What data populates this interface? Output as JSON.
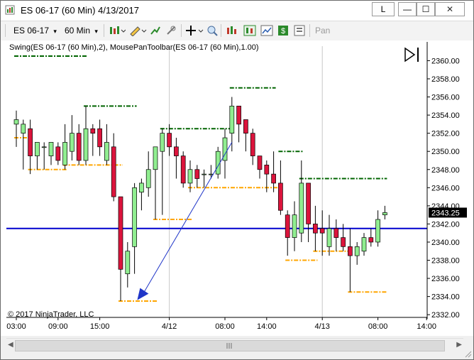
{
  "window": {
    "title": "ES 06-17 (60 Min)  4/13/2017",
    "buttons": {
      "link": "L",
      "minimize": "—",
      "maximize": "☐",
      "close": "✕"
    }
  },
  "toolbar": {
    "instrument": "ES 06-17",
    "interval": "60 Min",
    "dropdown_glyph": "▾",
    "pan_label": "Pan",
    "icons": [
      "bar-type-icon",
      "draw-pencil-icon",
      "indicator-icon",
      "attach-icon",
      "crosshair-icon",
      "zoom-icon",
      "strategies-icon",
      "data-box-icon",
      "chart-trader-icon",
      "dollar-icon",
      "properties-icon"
    ]
  },
  "chart": {
    "indicator_label": "Swing(ES 06-17 (60 Min),2), MousePanToolbar(ES 06-17 (60 Min),1.00)",
    "copyright": "© 2017 NinjaTrader, LLC",
    "last_price_label": "2343.25",
    "horizontal_line_price": 2341.5,
    "colors": {
      "up": "#90ee90",
      "down": "#dc143c",
      "wick": "#000000",
      "swing_high": "#006400",
      "swing_low": "#ffa500",
      "hline": "#0000cd",
      "arrow": "#1f35c8"
    },
    "x_ticks": [
      "03:00",
      "09:00",
      "15:00",
      "4/12",
      "08:00",
      "14:00",
      "4/13",
      "08:00",
      "14:00"
    ]
  },
  "chart_data": {
    "type": "candlestick",
    "y_ticks": [
      2332.0,
      2334.0,
      2336.0,
      2338.0,
      2340.0,
      2342.0,
      2344.0,
      2346.0,
      2348.0,
      2350.0,
      2352.0,
      2354.0,
      2356.0,
      2358.0,
      2360.0
    ],
    "ylim": [
      2331.7,
      2361.6
    ],
    "candles": [
      [
        2353.0,
        2354.5,
        2350.5,
        2353.5
      ],
      [
        2352.0,
        2353.5,
        2348.0,
        2353.0
      ],
      [
        2352.5,
        2353.5,
        2347.5,
        2349.5
      ],
      [
        2349.5,
        2351.0,
        2348.0,
        2351.0
      ],
      [
        2350.5,
        2351.0,
        2348.0,
        2350.5
      ],
      [
        2349.5,
        2351.0,
        2348.5,
        2351.0
      ],
      [
        2350.5,
        2351.0,
        2348.5,
        2349.0
      ],
      [
        2348.5,
        2353.0,
        2348.0,
        2351.0
      ],
      [
        2350.0,
        2354.0,
        2349.0,
        2352.0
      ],
      [
        2352.0,
        2353.0,
        2348.5,
        2349.0
      ],
      [
        2349.0,
        2355.0,
        2348.5,
        2352.5
      ],
      [
        2352.5,
        2353.0,
        2349.5,
        2352.0
      ],
      [
        2352.5,
        2353.5,
        2349.5,
        2350.5
      ],
      [
        2349.0,
        2353.0,
        2348.5,
        2351.0
      ],
      [
        2350.5,
        2352.0,
        2344.5,
        2345.0
      ],
      [
        2345.0,
        2345.0,
        2333.5,
        2337.0
      ],
      [
        2336.5,
        2340.0,
        2335.0,
        2339.0
      ],
      [
        2339.5,
        2346.5,
        2336.5,
        2346.0
      ],
      [
        2345.5,
        2347.0,
        2343.5,
        2346.5
      ],
      [
        2346.0,
        2350.0,
        2345.0,
        2348.0
      ],
      [
        2348.0,
        2350.5,
        2342.5,
        2350.5
      ],
      [
        2350.0,
        2352.5,
        2343.0,
        2352.0
      ],
      [
        2352.0,
        2353.0,
        2349.5,
        2350.5
      ],
      [
        2350.5,
        2351.5,
        2347.0,
        2349.5
      ],
      [
        2349.5,
        2350.0,
        2346.0,
        2346.5
      ],
      [
        2346.5,
        2349.0,
        2345.5,
        2348.0
      ],
      [
        2348.0,
        2348.5,
        2346.0,
        2347.0
      ],
      [
        2347.5,
        2348.0,
        2346.0,
        2347.5
      ],
      [
        2347.5,
        2348.5,
        2347.0,
        2347.5
      ],
      [
        2347.5,
        2350.5,
        2347.0,
        2350.0
      ],
      [
        2349.0,
        2352.5,
        2347.0,
        2351.5
      ],
      [
        2352.0,
        2356.0,
        2350.0,
        2355.0
      ],
      [
        2355.0,
        2355.0,
        2351.0,
        2353.0
      ],
      [
        2353.5,
        2353.5,
        2350.0,
        2352.0
      ],
      [
        2352.0,
        2352.5,
        2348.5,
        2349.5
      ],
      [
        2349.5,
        2349.5,
        2347.0,
        2348.0
      ],
      [
        2348.5,
        2349.0,
        2345.5,
        2347.5
      ],
      [
        2347.5,
        2350.0,
        2345.5,
        2346.5
      ],
      [
        2346.5,
        2349.0,
        2343.0,
        2343.5
      ],
      [
        2343.0,
        2343.5,
        2338.5,
        2340.5
      ],
      [
        2340.5,
        2344.5,
        2339.0,
        2343.0
      ],
      [
        2341.0,
        2349.0,
        2340.0,
        2346.5
      ],
      [
        2346.5,
        2346.5,
        2340.0,
        2342.0
      ],
      [
        2342.0,
        2344.0,
        2339.0,
        2341.0
      ],
      [
        2341.5,
        2343.5,
        2338.5,
        2341.0
      ],
      [
        2339.5,
        2343.0,
        2338.5,
        2341.5
      ],
      [
        2341.5,
        2342.5,
        2339.0,
        2340.5
      ],
      [
        2340.5,
        2342.0,
        2339.0,
        2339.5
      ],
      [
        2339.5,
        2341.5,
        2334.5,
        2338.5
      ],
      [
        2338.5,
        2340.0,
        2337.5,
        2339.5
      ],
      [
        2339.0,
        2341.0,
        2338.5,
        2340.5
      ],
      [
        2340.5,
        2341.5,
        2339.5,
        2340.0
      ],
      [
        2340.0,
        2343.5,
        2339.5,
        2342.5
      ],
      [
        2343.0,
        2344.0,
        2342.5,
        2343.25
      ]
    ],
    "swing_highs": [
      {
        "price": 2360.5,
        "from": 0,
        "to": 10
      },
      {
        "price": 2355.0,
        "from": 10,
        "to": 17
      },
      {
        "price": 2352.5,
        "from": 21,
        "to": 31
      },
      {
        "price": 2357.0,
        "from": 31,
        "to": 37
      },
      {
        "price": 2350.0,
        "from": 38,
        "to": 41
      },
      {
        "price": 2347.0,
        "from": 41,
        "to": 53
      }
    ],
    "swing_lows": [
      {
        "price": 2351.5,
        "from": 0,
        "to": 2
      },
      {
        "price": 2348.0,
        "from": 2,
        "to": 7
      },
      {
        "price": 2348.5,
        "from": 7,
        "to": 15
      },
      {
        "price": 2333.5,
        "from": 15,
        "to": 20
      },
      {
        "price": 2342.5,
        "from": 20,
        "to": 25
      },
      {
        "price": 2346.0,
        "from": 25,
        "to": 38
      },
      {
        "price": 2338.0,
        "from": 39,
        "to": 43
      },
      {
        "price": 2339.0,
        "from": 43,
        "to": 48
      },
      {
        "price": 2334.5,
        "from": 48,
        "to": 53
      }
    ],
    "trend_line": {
      "from": [
        18,
        2334.0
      ],
      "to": [
        31,
        2351.0
      ]
    },
    "session_dividers": [
      22,
      44
    ]
  }
}
